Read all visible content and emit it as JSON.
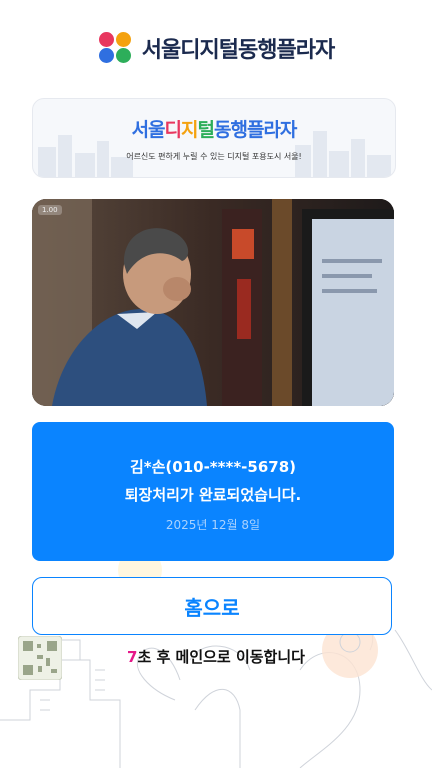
{
  "header": {
    "logo_text": "서울디지털동행플라자"
  },
  "banner": {
    "title_parts": [
      "서울",
      "디",
      "지",
      "털",
      "동행플라자"
    ],
    "subtitle": "어르신도 편하게 누릴 수 있는 디지털 포용도시 서울!"
  },
  "video": {
    "speed_label": "1.00"
  },
  "result": {
    "user": "김*손(010-****-5678)",
    "message": "퇴장처리가 완료되었습니다.",
    "date": "2025년 12월 8일"
  },
  "home_button": {
    "label": "홈으로"
  },
  "countdown": {
    "seconds": "7",
    "text": "초 후 메인으로 이동합니다"
  },
  "colors": {
    "primary": "#0a84ff",
    "countdown_number": "#e6198a",
    "logo_text": "#1b2a4e"
  }
}
